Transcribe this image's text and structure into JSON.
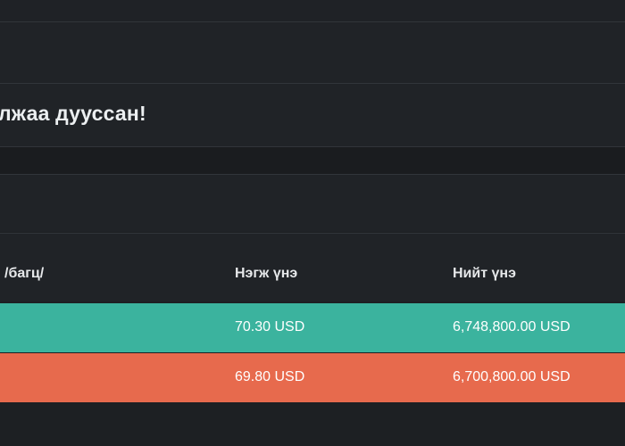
{
  "heading": {
    "title": "лжаа дууссан!"
  },
  "table": {
    "columns": {
      "qty_suffix": "/багц/",
      "unit_price": "Нэгж үнэ",
      "total_price": "Нийт үнэ"
    },
    "rows": [
      {
        "unit_price": "70.30 USD",
        "total_price": "6,748,800.00 USD",
        "color": "#3bb39e"
      },
      {
        "unit_price": "69.80 USD",
        "total_price": "6,700,800.00 USD",
        "color": "#e76a4d"
      }
    ]
  },
  "colors": {
    "background": "#1d2023",
    "panel": "#202327",
    "divider": "#31353a",
    "buy_row": "#3bb39e",
    "sell_row": "#e76a4d"
  }
}
